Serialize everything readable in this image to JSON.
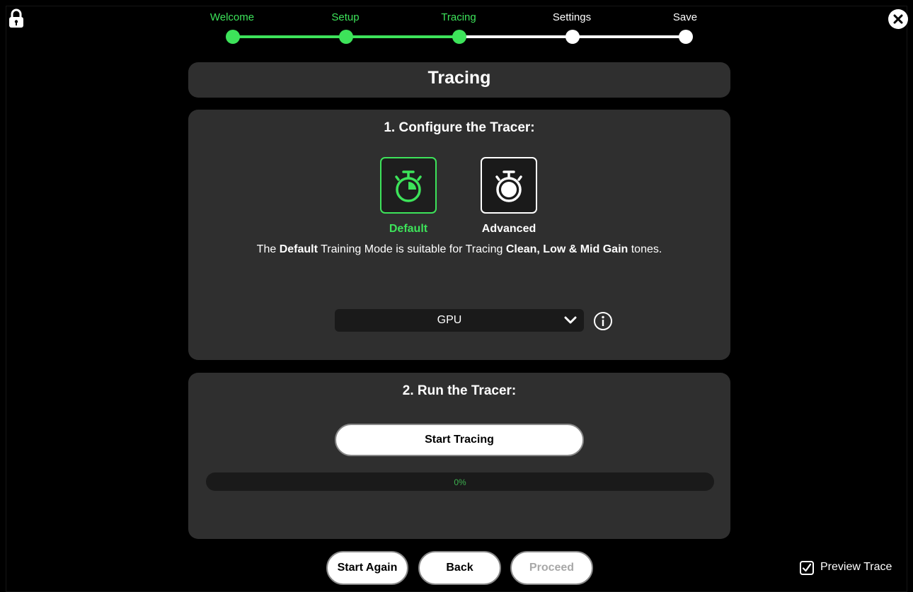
{
  "steps": [
    {
      "label": "Welcome",
      "state": "done"
    },
    {
      "label": "Setup",
      "state": "done"
    },
    {
      "label": "Tracing",
      "state": "done"
    },
    {
      "label": "Settings",
      "state": "todo"
    },
    {
      "label": "Save",
      "state": "todo"
    }
  ],
  "page_title": "Tracing",
  "configure": {
    "heading": "1. Configure the Tracer:",
    "modes": [
      {
        "label": "Default",
        "icon": "stopwatch-icon",
        "selected": true
      },
      {
        "label": "Advanced",
        "icon": "stopwatch-icon",
        "selected": false
      }
    ],
    "desc_parts": {
      "p1": "The ",
      "b1": "Default",
      "p2": " Training Mode is suitable for Tracing ",
      "b2": "Clean, Low & Mid Gain",
      "p3": " tones."
    },
    "device_select": "GPU",
    "info_icon": "info-icon"
  },
  "run": {
    "heading": "2. Run the Tracer:",
    "start_button": "Start Tracing",
    "progress_text": "0%",
    "progress_value": 0
  },
  "footer": {
    "start_again": "Start Again",
    "back": "Back",
    "proceed": "Proceed",
    "preview_label": "Preview Trace",
    "preview_checked": true
  },
  "colors": {
    "accent": "#3de35a",
    "panel": "#2f2f2f",
    "background": "#000000"
  }
}
